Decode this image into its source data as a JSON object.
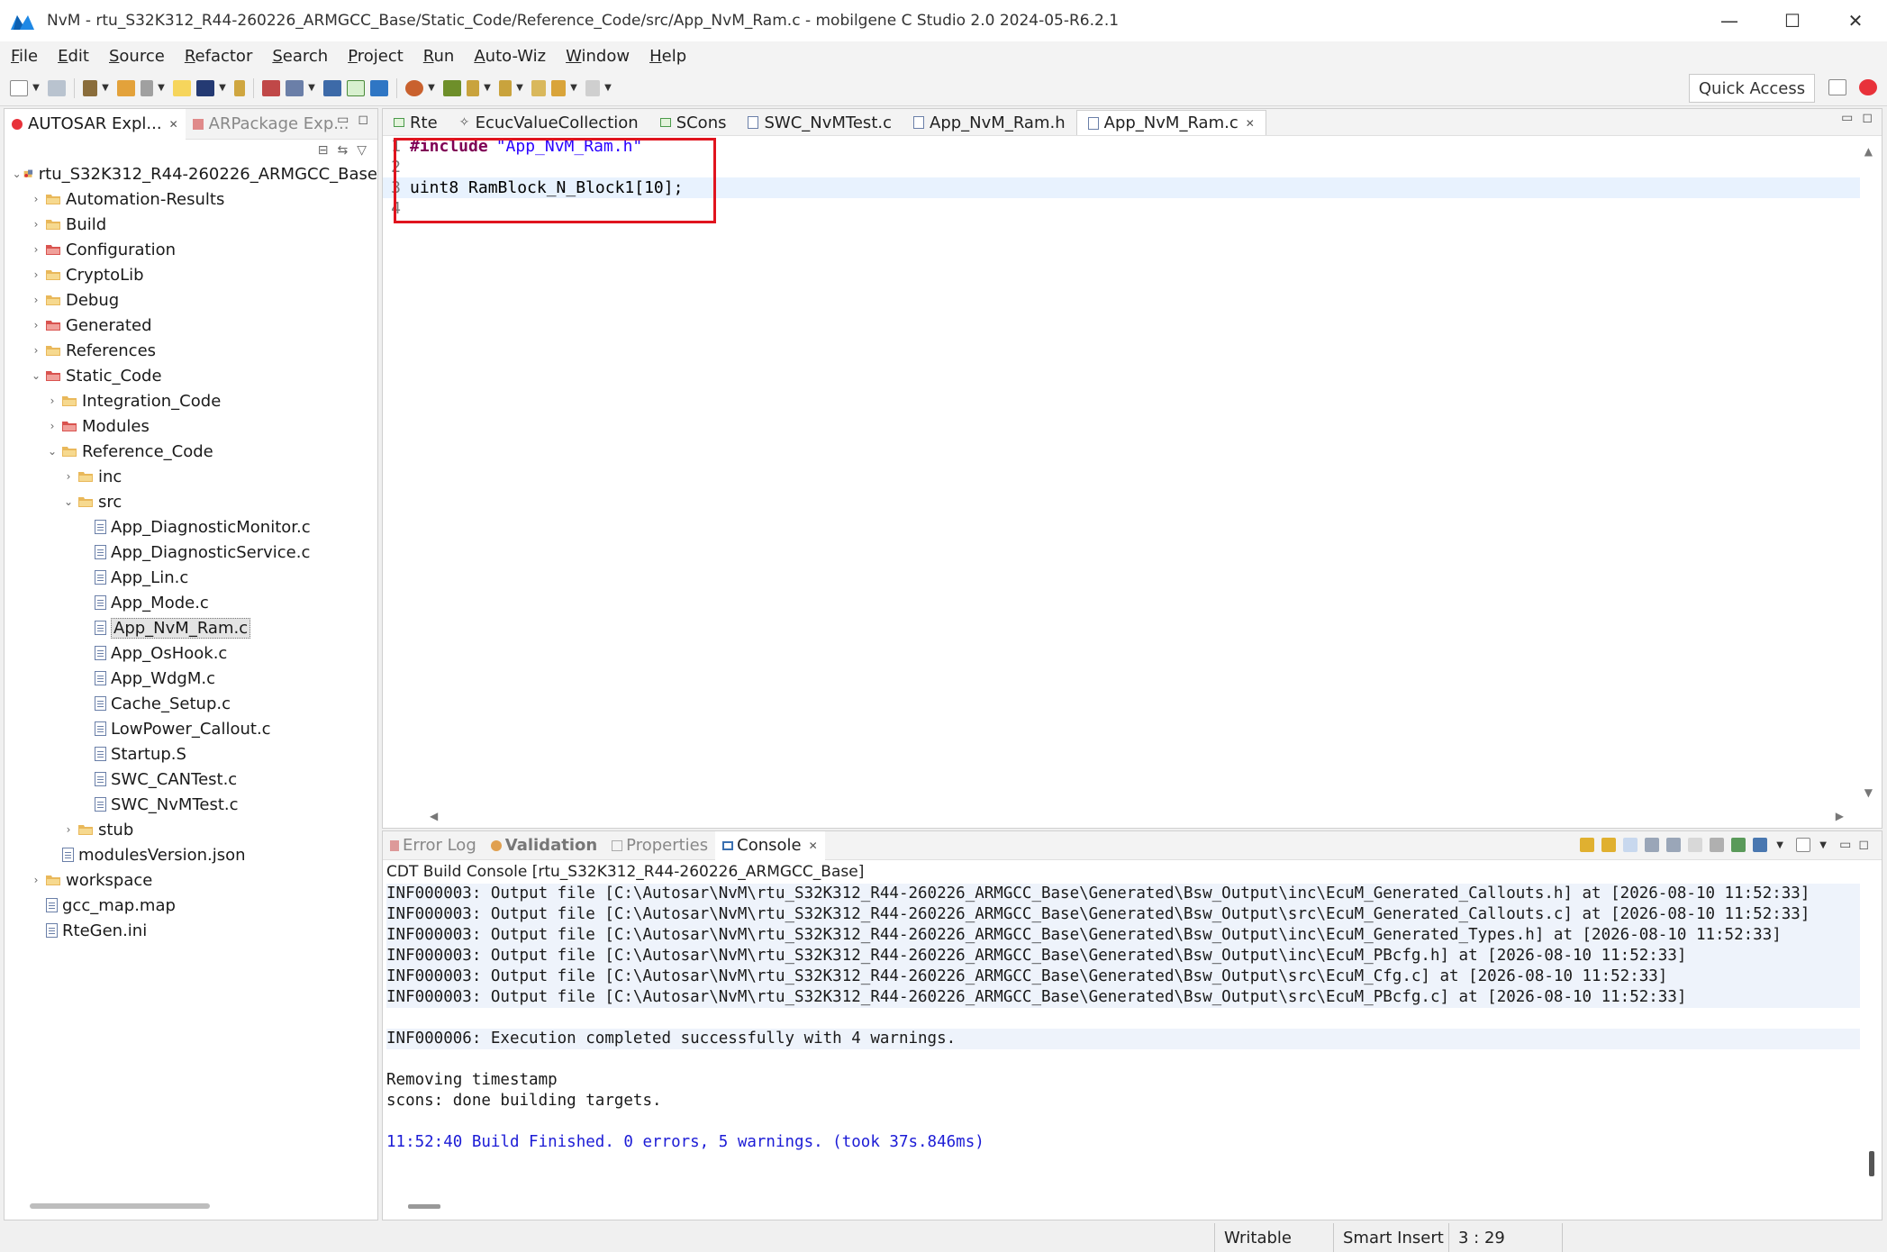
{
  "window": {
    "title": "NvM - rtu_S32K312_R44-260226_ARMGCC_Base/Static_Code/Reference_Code/src/App_NvM_Ram.c - mobilgene C Studio 2.0 2024-05-R6.2.1",
    "minimize": "—",
    "maximize": "☐",
    "close": "✕"
  },
  "menu": [
    "File",
    "Edit",
    "Source",
    "Refactor",
    "Search",
    "Project",
    "Run",
    "Auto-Wiz",
    "Window",
    "Help"
  ],
  "toolbar": {
    "quick_access": "Quick Access"
  },
  "left_panel": {
    "tabs": [
      {
        "label": "AUTOSAR Expl...",
        "active": true
      },
      {
        "label": "ARPackage Exp...",
        "active": false
      }
    ],
    "tree": [
      {
        "label": "rtu_S32K312_R44-260226_ARMGCC_Base",
        "depth": 0,
        "type": "project",
        "expanded": true
      },
      {
        "label": "Automation-Results",
        "depth": 1,
        "type": "folder",
        "expandable": true
      },
      {
        "label": "Build",
        "depth": 1,
        "type": "folder",
        "expandable": true
      },
      {
        "label": "Configuration",
        "depth": 1,
        "type": "folder-red",
        "expandable": true
      },
      {
        "label": "CryptoLib",
        "depth": 1,
        "type": "folder",
        "expandable": true
      },
      {
        "label": "Debug",
        "depth": 1,
        "type": "folder",
        "expandable": true
      },
      {
        "label": "Generated",
        "depth": 1,
        "type": "folder-red",
        "expandable": true
      },
      {
        "label": "References",
        "depth": 1,
        "type": "folder",
        "expandable": true
      },
      {
        "label": "Static_Code",
        "depth": 1,
        "type": "folder-red",
        "expanded": true
      },
      {
        "label": "Integration_Code",
        "depth": 2,
        "type": "folder",
        "expandable": true
      },
      {
        "label": "Modules",
        "depth": 2,
        "type": "folder-red",
        "expandable": true
      },
      {
        "label": "Reference_Code",
        "depth": 2,
        "type": "folder",
        "expanded": true
      },
      {
        "label": "inc",
        "depth": 3,
        "type": "folder",
        "expandable": true
      },
      {
        "label": "src",
        "depth": 3,
        "type": "folder",
        "expanded": true
      },
      {
        "label": "App_DiagnosticMonitor.c",
        "depth": 4,
        "type": "file"
      },
      {
        "label": "App_DiagnosticService.c",
        "depth": 4,
        "type": "file"
      },
      {
        "label": "App_Lin.c",
        "depth": 4,
        "type": "file"
      },
      {
        "label": "App_Mode.c",
        "depth": 4,
        "type": "file"
      },
      {
        "label": "App_NvM_Ram.c",
        "depth": 4,
        "type": "file",
        "selected": true
      },
      {
        "label": "App_OsHook.c",
        "depth": 4,
        "type": "file"
      },
      {
        "label": "App_WdgM.c",
        "depth": 4,
        "type": "file"
      },
      {
        "label": "Cache_Setup.c",
        "depth": 4,
        "type": "file"
      },
      {
        "label": "LowPower_Callout.c",
        "depth": 4,
        "type": "file"
      },
      {
        "label": "Startup.S",
        "depth": 4,
        "type": "file"
      },
      {
        "label": "SWC_CANTest.c",
        "depth": 4,
        "type": "file"
      },
      {
        "label": "SWC_NvMTest.c",
        "depth": 4,
        "type": "file"
      },
      {
        "label": "stub",
        "depth": 3,
        "type": "folder",
        "expandable": true
      },
      {
        "label": "modulesVersion.json",
        "depth": 2,
        "type": "file"
      },
      {
        "label": "workspace",
        "depth": 1,
        "type": "folder",
        "expandable": true
      },
      {
        "label": "gcc_map.map",
        "depth": 1,
        "type": "file"
      },
      {
        "label": "RteGen.ini",
        "depth": 1,
        "type": "file"
      }
    ]
  },
  "editor": {
    "tabs": [
      {
        "label": "Rte",
        "icon": "rte",
        "active": false
      },
      {
        "label": "EcucValueCollection",
        "icon": "ecuc",
        "active": false
      },
      {
        "label": "SCons",
        "icon": "scons",
        "active": false
      },
      {
        "label": "SWC_NvMTest.c",
        "icon": "cfile",
        "active": false
      },
      {
        "label": "App_NvM_Ram.h",
        "icon": "hfile",
        "active": false
      },
      {
        "label": "App_NvM_Ram.c",
        "icon": "cfile",
        "active": true
      }
    ],
    "lines": [
      {
        "num": "1",
        "kw": "#include",
        "str": "\"App_NvM_Ram.h\"",
        "plain": ""
      },
      {
        "num": "2",
        "kw": "",
        "str": "",
        "plain": ""
      },
      {
        "num": "3",
        "kw": "",
        "str": "",
        "plain": "uint8 RamBlock_N_Block1[10];"
      },
      {
        "num": "4",
        "kw": "",
        "str": "",
        "plain": ""
      }
    ]
  },
  "bottom_panel": {
    "tabs": [
      {
        "label": "Error Log",
        "active": false,
        "bold": false
      },
      {
        "label": "Validation",
        "active": false,
        "bold": true
      },
      {
        "label": "Properties",
        "active": false,
        "bold": false
      },
      {
        "label": "Console",
        "active": true,
        "bold": false
      }
    ],
    "console_title": "CDT Build Console [rtu_S32K312_R44-260226_ARMGCC_Base]",
    "lines": [
      {
        "text": "INF000003: Output file [C:\\Autosar\\NvM\\rtu_S32K312_R44-260226_ARMGCC_Base\\Generated\\Bsw_Output\\inc\\EcuM_Generated_Callouts.h] at [2026-08-10 11:52:33]",
        "style": "alt"
      },
      {
        "text": "INF000003: Output file [C:\\Autosar\\NvM\\rtu_S32K312_R44-260226_ARMGCC_Base\\Generated\\Bsw_Output\\src\\EcuM_Generated_Callouts.c] at [2026-08-10 11:52:33]",
        "style": "alt"
      },
      {
        "text": "INF000003: Output file [C:\\Autosar\\NvM\\rtu_S32K312_R44-260226_ARMGCC_Base\\Generated\\Bsw_Output\\inc\\EcuM_Generated_Types.h] at [2026-08-10 11:52:33]",
        "style": "alt"
      },
      {
        "text": "INF000003: Output file [C:\\Autosar\\NvM\\rtu_S32K312_R44-260226_ARMGCC_Base\\Generated\\Bsw_Output\\inc\\EcuM_PBcfg.h] at [2026-08-10 11:52:33]",
        "style": "alt"
      },
      {
        "text": "INF000003: Output file [C:\\Autosar\\NvM\\rtu_S32K312_R44-260226_ARMGCC_Base\\Generated\\Bsw_Output\\src\\EcuM_Cfg.c] at [2026-08-10 11:52:33]",
        "style": "alt"
      },
      {
        "text": "INF000003: Output file [C:\\Autosar\\NvM\\rtu_S32K312_R44-260226_ARMGCC_Base\\Generated\\Bsw_Output\\src\\EcuM_PBcfg.c] at [2026-08-10 11:52:33]",
        "style": "alt"
      },
      {
        "text": "",
        "style": ""
      },
      {
        "text": "INF000006: Execution completed successfully with 4 warnings.",
        "style": "alt"
      },
      {
        "text": "",
        "style": ""
      },
      {
        "text": "Removing timestamp",
        "style": ""
      },
      {
        "text": "scons: done building targets.",
        "style": ""
      },
      {
        "text": "",
        "style": ""
      },
      {
        "text": "11:52:40 Build Finished. 0 errors, 5 warnings. (took 37s.846ms)",
        "style": "blue"
      }
    ]
  },
  "status": {
    "writable": "Writable",
    "insert_mode": "Smart Insert",
    "position": "3 : 29"
  },
  "colors": {
    "highlight_box": "#e0141e",
    "keyword": "#7f0055",
    "string": "#2a00ff",
    "build_finished": "#1c1cd6"
  }
}
